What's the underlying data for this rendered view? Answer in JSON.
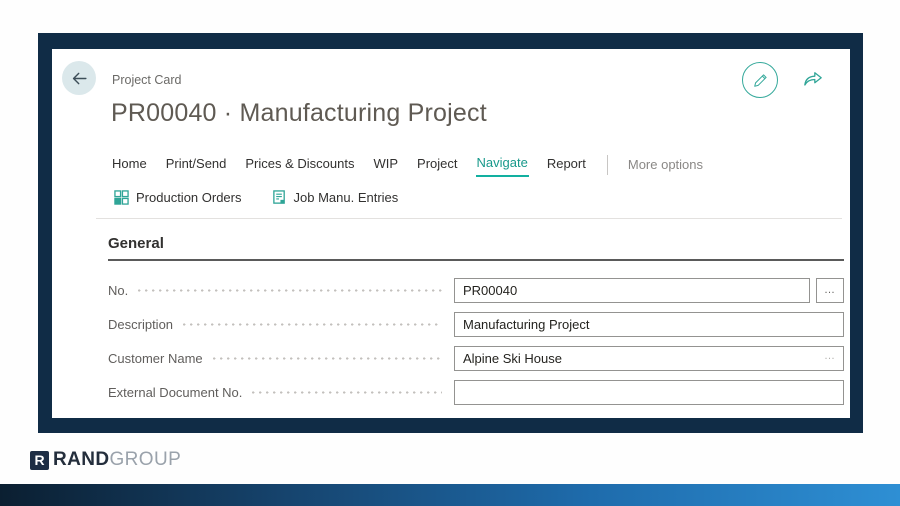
{
  "page": {
    "caption": "Project Card",
    "title": "PR00040 · Manufacturing Project"
  },
  "menu": {
    "items": [
      "Home",
      "Print/Send",
      "Prices & Discounts",
      "WIP",
      "Project",
      "Navigate",
      "Report"
    ],
    "active_item": "Navigate",
    "more_label": "More options"
  },
  "toolbar": {
    "items": [
      {
        "label": "Production Orders",
        "icon": "production-orders-icon"
      },
      {
        "label": "Job Manu. Entries",
        "icon": "job-entries-icon"
      }
    ]
  },
  "section": {
    "title": "General"
  },
  "form": {
    "fields": [
      {
        "label": "No.",
        "value": "PR00040",
        "assist_button": "…"
      },
      {
        "label": "Description",
        "value": "Manufacturing Project"
      },
      {
        "label": "Customer Name",
        "value": "Alpine Ski House",
        "lookup_ellipsis": "…"
      },
      {
        "label": "External Document No.",
        "value": ""
      }
    ]
  },
  "footer": {
    "logo_letter": "R",
    "brand_bold": "RAND",
    "brand_light": "GROUP"
  },
  "colors": {
    "accent_teal": "#18998b",
    "accent_teal_underline": "#12b0a0",
    "frame_navy": "#102c46",
    "bar_gradient_start": "#0b1f31",
    "bar_gradient_end": "#2e8fd4",
    "field_border": "#949391",
    "label_gray": "#605e5c",
    "title_gray": "#5f5a53"
  }
}
